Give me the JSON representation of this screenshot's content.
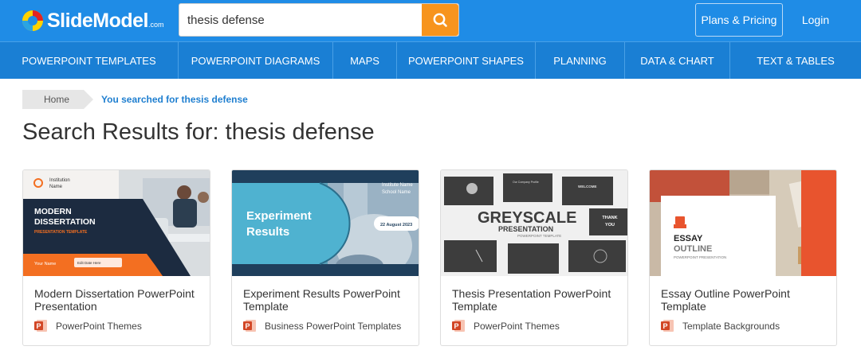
{
  "header": {
    "logo_text": "SlideModel",
    "logo_suffix": ".com",
    "search_value": "thesis defense",
    "plans_label": "Plans & Pricing",
    "login_label": "Login"
  },
  "nav": [
    "POWERPOINT TEMPLATES",
    "POWERPOINT DIAGRAMS",
    "MAPS",
    "POWERPOINT SHAPES",
    "PLANNING",
    "DATA & CHART",
    "TEXT & TABLES"
  ],
  "breadcrumb": {
    "home": "Home",
    "current": "You searched for thesis defense"
  },
  "page_title": "Search Results for: thesis defense",
  "cards": [
    {
      "title": "Modern Dissertation PowerPoint Presentation",
      "category": "PowerPoint Themes",
      "thumb": {
        "institution": "Institution",
        "institution_name": "Name",
        "line1": "MODERN",
        "line2": "DISSERTATION",
        "line3": "PRESENTATION TEMPLATE",
        "your_name": "Your Name",
        "edit_date": "Edit Date Here"
      }
    },
    {
      "title": "Experiment Results PowerPoint Template",
      "category": "Business PowerPoint Templates",
      "thumb": {
        "line1": "Experiment",
        "line2": "Results",
        "inst1": "Institute Name",
        "inst2": "School Name",
        "date": "22 August 2023"
      }
    },
    {
      "title": "Thesis Presentation PowerPoint Template",
      "category": "PowerPoint Themes",
      "thumb": {
        "big": "GREYSCALE",
        "sub": "PRESENTATION",
        "sub2": "POWERPOINT TEMPLATE",
        "thanks1": "THANK",
        "thanks2": "YOU",
        "welcome": "WELCOME",
        "company": "Our Company Profile"
      }
    },
    {
      "title": "Essay Outline PowerPoint Template",
      "category": "Template Backgrounds",
      "thumb": {
        "line1": "ESSAY",
        "line2": "OUTLINE",
        "line3": "POWERPOINT PRESENTATION"
      }
    }
  ]
}
